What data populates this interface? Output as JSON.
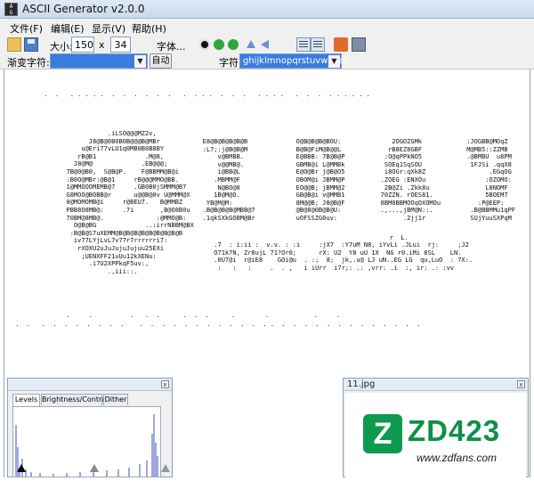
{
  "window": {
    "title": "ASCII Generator v2.0.0",
    "icon_text": "ASC\nGEN"
  },
  "menu": [
    {
      "label": "文件(F)"
    },
    {
      "label": "编辑(E)"
    },
    {
      "label": "显示(V)"
    },
    {
      "label": "帮助(H)"
    }
  ],
  "toolbar": {
    "size_label": "大小:",
    "width_value": "150",
    "times": "x",
    "height_value": "34",
    "font_label": "字体..."
  },
  "toolbar2": {
    "ramp_label": "渐变字符:",
    "ramp_value": "",
    "auto_label": "自动",
    "chars_label": "字符:",
    "chars_value": "ghijklmnopqrstuvwxyz$"
  },
  "ascii_art": {
    "top_dots": " .  .   . . . . .  .  .  .  .  .  .   .  . . .  .  .  .   . . . .   .  .  .  . . . . . .",
    "big_letter": "                  .iLSO@@@MZ2v,\n             J8@B@0B0B0B@@@B@MBr\n           u@Eri77vLU1q0MB0B0B8BY\n          rB@B1             .M@8,\n         J8@M@             .EB@@@;\n       7B@0@B0,  S@B@P.    F@BBMM@B@i\n       :B0O@MBr:@B@1     rB@@@MMO@BB.\n       1@MMOOOMEMB@7     .GB0B0jSMMM@B7\n       G8MOO@BOBB@r      u@@B@0v U@MMM@X\n       0@MOMOMB@i     r@BEU7.   B@MMBZ\n       PBB8O8MB@:     .7i       ,B@O8B0u\n       70BM@8MB@.              :@MMO@B:\n         O@B@BG             ..:irrNBBM@BX\n        :B@B@S7uXEMM@B@B@B@B@B@B@B@B@B\n         iv77LYjLvL7v77r7rrrrrri7:\n          rXOXU2uJuJujuJujuu25EXi\n           ;UENXFF21uUu12kXENu:\n             .i7U2XPPkqF5uv:,\n                  .,iii::.",
    "col2": "   E8@B@B@B@B@B\n   :L7;:j@B@B@M\n       v@BMBB.\n       v@@MB@.\n       i@BB@L\n      .MBMM@F\n       N@BO@8\n      1B@M@O.\n    YB@M@M:\n   .B@B@B@B@MBB@7\n   .1qkSXkGOBM@Br",
    "col3": "   O@B@B@B@BOU:\n   B@B@FiM@B@@L\n   E@BBB: 7B@B@P\n   GBMB@i L@MMBk\n   E@O@Br j@B@O5\n   OBOM@i JBMM@P\n   EO@@B; jBMM@2\n   GB@B@i v@MMB1\n   8M@@B; J8@B@F\n   @B@8@0B@B@U:\n   uOFSSZG0uv:",
    "col4": "      2OGOZGMk\n     rB8EZ8GBF\n    :O@qPPkNO5\n    SOEq1SqSOU\n    i8OGr:qXk8Z\n   .ZOEG :ENXOu\n    2B@Zi .Zkk8u\n   70ZZN. rOES81.\n   8BM0BBMOOqOXOMOu\n   .,...,jBM@N::.\n         .2jj1r",
    "col5": " :JOGBB@MOqZ\n M@MB5::ZZMB\n .@BMBU  u8PM\n  1FJSi .qqX8\n       .EGqOG\n      :OZOMO:\n      L8NOMF\n      5BOEM7\n    :P@EEP:\n  .B@BBMMu1qPF\n  SUjYuuSXPqM",
    "rows_lower": "      .7  : i:ii :  v.v. : :i     :jX7  :Y7uM N8, iYvLi .JLui  rj:     ;J2\n      O71k7N, Zr8ujL 71?Or0;      rX: U2  Y8 uU 1X  NG r0.iMi 8SL    LN.\n      .0U7@i  r@iE8    GOi@u  . :;  8;  jk,.u@ LJ uN..EG LG  qu,LuO  : 7X:.\n       :   :   :     .  . ,   i iUrr  i7r;: .: ,vrr: .i  :, ir: .: :vv",
    "dot_row1": "       .     .          .   .  .      .  .  .      .        .            .     .",
    "dot_row2": " .  .   .  .  .  .  .  .  .  .    .  .  .  .  .  .  .  .  .  .  .  . .  .  .  .  .  .  .  .  .  .  .  .  .  .",
    "small_l": "   r  L.",
    "small_row": "   :",
    "extra_right": "."
  },
  "levels_panel": {
    "tabs": [
      {
        "label": "Levels"
      },
      {
        "label": "Brightness/Contrast"
      },
      {
        "label": "Dither"
      }
    ],
    "active_tab": "Levels",
    "levels": {
      "black": 0,
      "mid": 0.5,
      "white": 1
    }
  },
  "preview_panel": {
    "title": "11.jpg",
    "logo_mark": "Z",
    "logo_word": "ZD423",
    "logo_url": "www.zdfans.com",
    "brand_color": "#0e9a4f"
  },
  "colors": {
    "selection": "#3a7de0",
    "titlebar": "#c9d9ed"
  }
}
